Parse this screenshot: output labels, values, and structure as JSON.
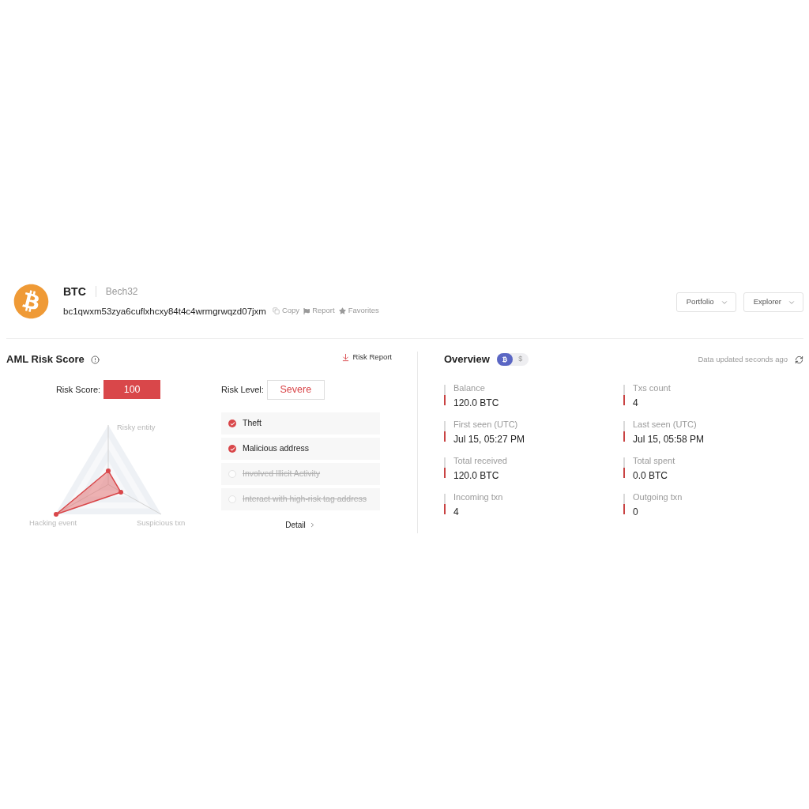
{
  "header": {
    "coin": "BTC",
    "address_format": "Bech32",
    "address": "bc1qwxm53zya6cuflxhcxy84t4c4wrmgrwqzd07jxm",
    "copy_label": "Copy",
    "report_label": "Report",
    "favorites_label": "Favorites"
  },
  "menus": [
    {
      "label": "Portfolio"
    },
    {
      "label": "Explorer"
    }
  ],
  "aml": {
    "title": "AML Risk Score",
    "report_link": "Risk Report",
    "score_label": "Risk Score:",
    "score": "100",
    "level_label": "Risk Level:",
    "level": "Severe",
    "radar_axes": [
      "Risky entity",
      "Hacking event",
      "Suspicious txn"
    ],
    "flags": [
      {
        "label": "Theft",
        "checked": true
      },
      {
        "label": "Malicious address",
        "checked": true
      },
      {
        "label": "Involved Illicit Activity",
        "checked": false
      },
      {
        "label": "Interact with high-risk tag address",
        "checked": false
      }
    ],
    "detail_link": "Detail"
  },
  "overview": {
    "title": "Overview",
    "currency_toggle": [
      {
        "kind": "btc",
        "selected": true
      },
      {
        "kind": "usd",
        "symbol": "$",
        "selected": false
      }
    ],
    "updated_text": "Data updated seconds ago",
    "stats": [
      {
        "label": "Balance",
        "value": "120.0 BTC"
      },
      {
        "label": "Txs count",
        "value": "4"
      },
      {
        "label": "First seen (UTC)",
        "value": "Jul 15, 05:27 PM"
      },
      {
        "label": "Last seen (UTC)",
        "value": "Jul 15, 05:58 PM"
      },
      {
        "label": "Total received",
        "value": "120.0 BTC"
      },
      {
        "label": "Total spent",
        "value": "0.0 BTC"
      },
      {
        "label": "Incoming txn",
        "value": "4"
      },
      {
        "label": "Outgoing txn",
        "value": "0"
      }
    ]
  }
}
